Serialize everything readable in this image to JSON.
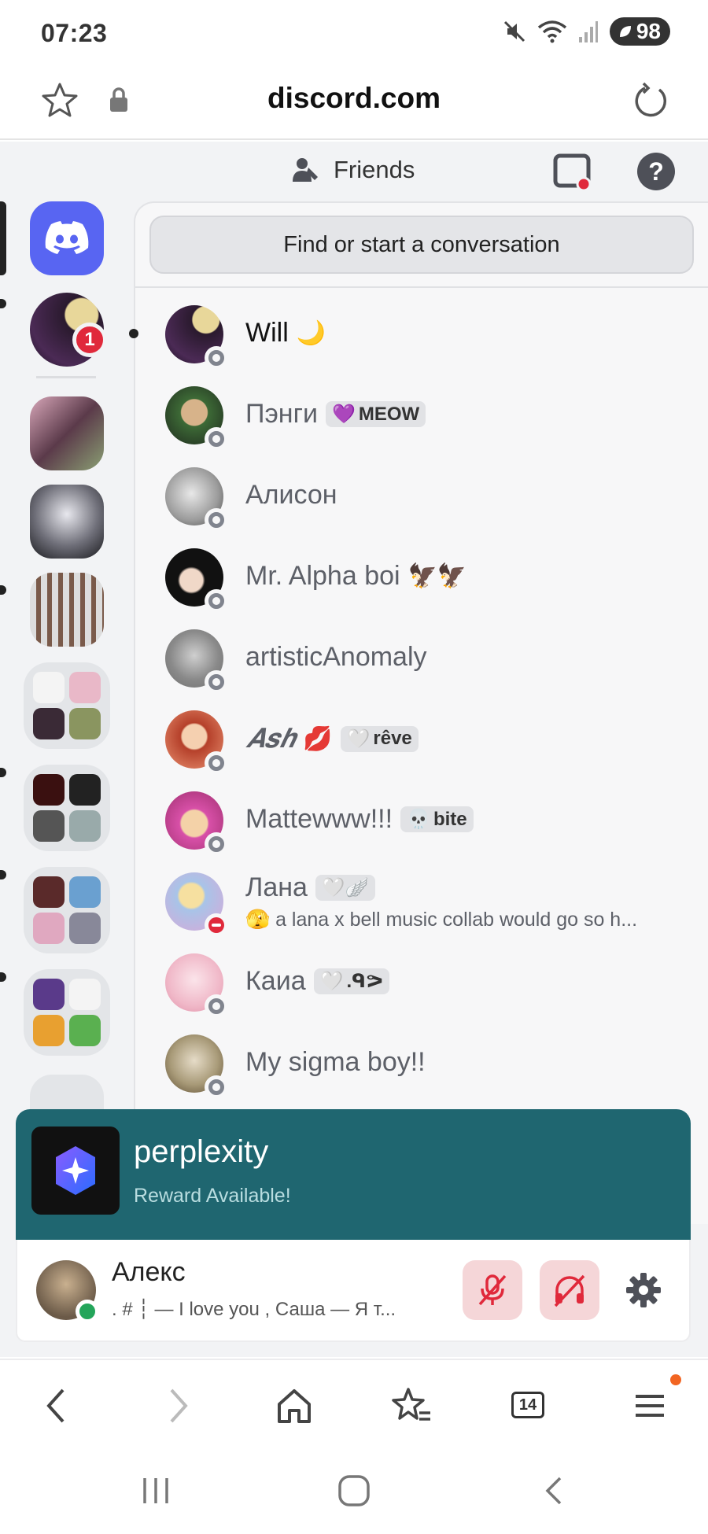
{
  "status_bar": {
    "time": "07:23",
    "battery": "98",
    "icons": [
      "mute-icon",
      "wifi-icon",
      "signal-icon",
      "battery-icon"
    ]
  },
  "browser": {
    "url": "discord.com",
    "tab_count": "14"
  },
  "header": {
    "title": "Friends"
  },
  "search": {
    "placeholder": "Find or start a conversation"
  },
  "server_rail": {
    "badge_count": "1"
  },
  "dms": [
    {
      "name": "Will",
      "emoji": "🌙",
      "tag": "",
      "tag_emoji": "",
      "status": "offline",
      "unread": true,
      "activity": ""
    },
    {
      "name": "Пэнги",
      "emoji": "",
      "tag": "MEOW",
      "tag_emoji": "💜",
      "status": "offline",
      "unread": false,
      "activity": ""
    },
    {
      "name": "Алисон",
      "emoji": "",
      "tag": "",
      "tag_emoji": "",
      "status": "offline",
      "unread": false,
      "activity": ""
    },
    {
      "name": "Mr. Alpha boi",
      "emoji": "🦅🦅",
      "tag": "",
      "tag_emoji": "",
      "status": "offline",
      "unread": false,
      "activity": ""
    },
    {
      "name": "artisticAnomaly",
      "emoji": "",
      "tag": "",
      "tag_emoji": "",
      "status": "offline",
      "unread": false,
      "activity": ""
    },
    {
      "name": "𝑨𝒔𝒉",
      "emoji": "💋",
      "tag": "rêve",
      "tag_emoji": "🤍",
      "status": "offline",
      "unread": false,
      "activity": ""
    },
    {
      "name": "Mattewww!!!",
      "emoji": "",
      "tag": "bite",
      "tag_emoji": "💀",
      "status": "offline",
      "unread": false,
      "activity": ""
    },
    {
      "name": "Лана",
      "emoji": "",
      "tag": "🤍🪽",
      "tag_emoji": "",
      "status": "dnd",
      "unread": false,
      "activity": "a lana x bell music collab would go so h..."
    },
    {
      "name": "Каиа",
      "emoji": "",
      "tag": ".ᑫᕗ",
      "tag_emoji": "🤍",
      "status": "offline",
      "unread": false,
      "activity": ""
    },
    {
      "name": "My sigma boy!!",
      "emoji": "",
      "tag": "",
      "tag_emoji": "",
      "status": "offline",
      "unread": false,
      "activity": ""
    }
  ],
  "promo": {
    "title": "perplexity",
    "subtitle": "Reward Available!"
  },
  "user": {
    "name": "Алекс",
    "status_text": ". # ┆ — I love you , Саша — Я т..."
  },
  "colors": {
    "blurple": "#5865f2",
    "promo_bg": "#1f6670",
    "danger": "#e0293b",
    "online": "#23a55a",
    "offline": "#80848e"
  }
}
